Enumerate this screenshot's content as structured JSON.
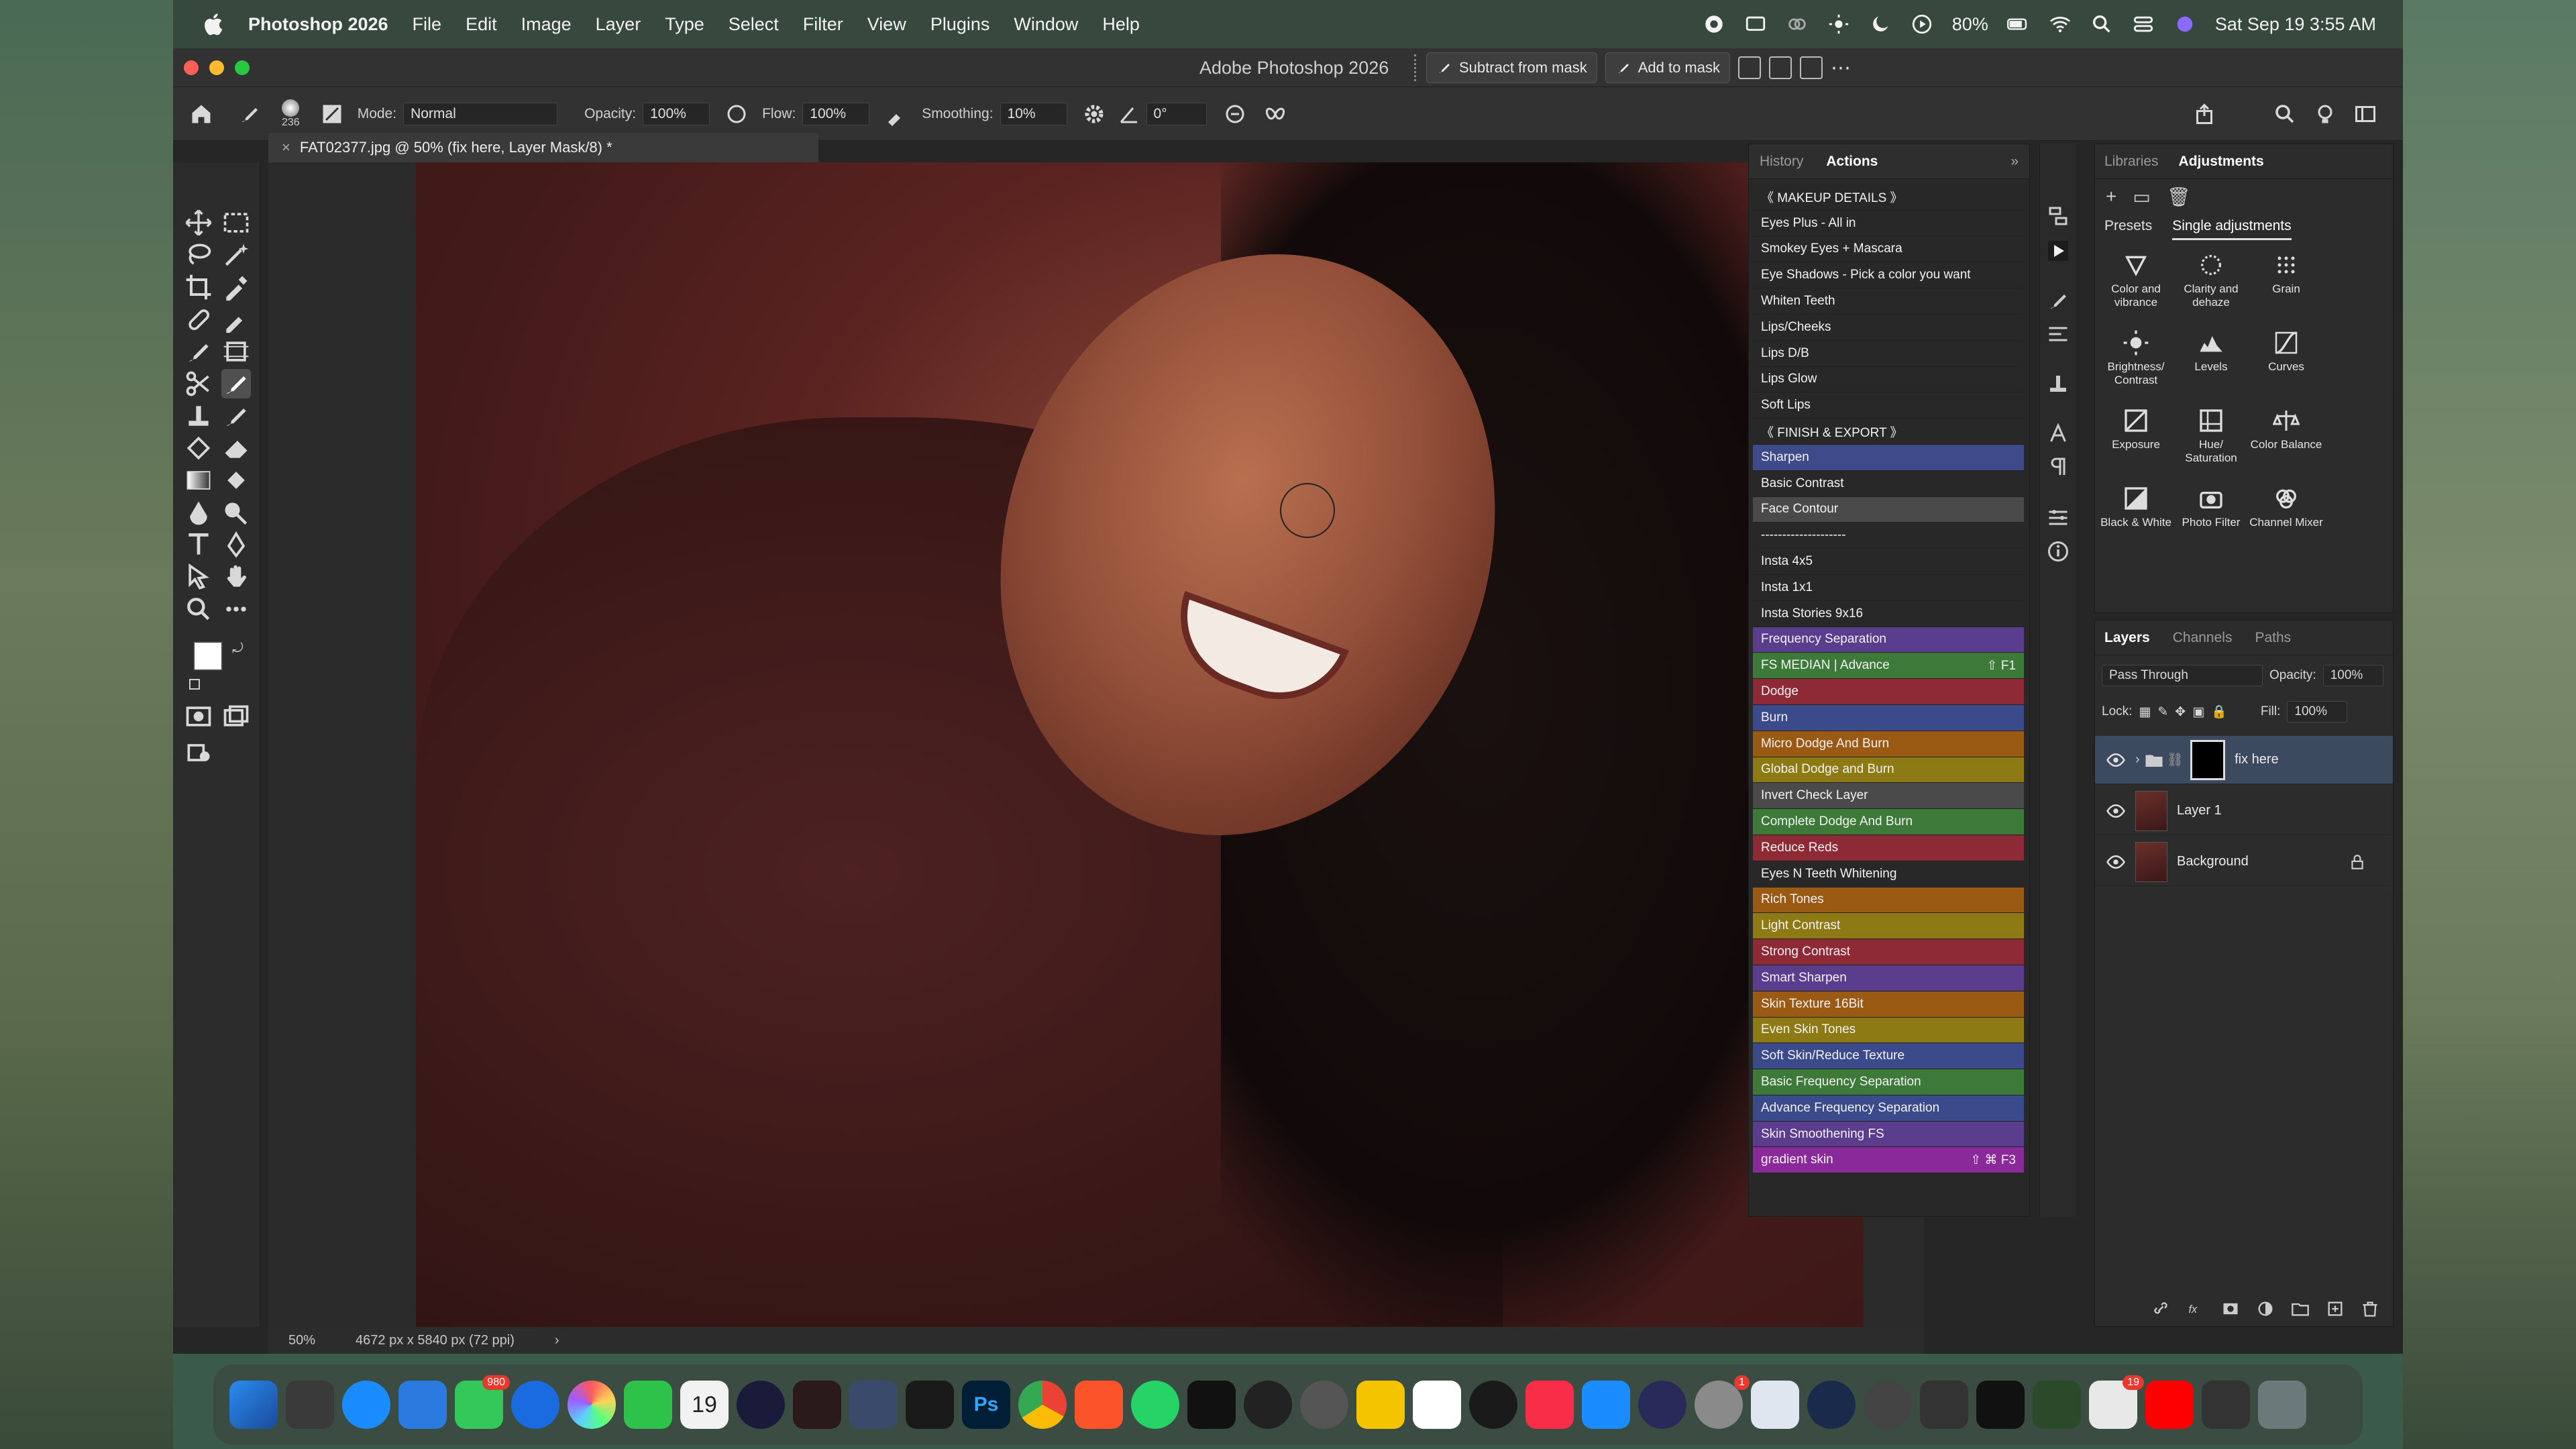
{
  "menubar": {
    "app_name": "Photoshop 2026",
    "items": [
      "File",
      "Edit",
      "Image",
      "Layer",
      "Type",
      "Select",
      "Filter",
      "View",
      "Plugins",
      "Window",
      "Help"
    ],
    "battery": "80%",
    "datetime": "Sat Sep 19  3:55 AM"
  },
  "window": {
    "title": "Adobe Photoshop 2026",
    "subtract_mask_label": "Subtract from mask",
    "add_mask_label": "Add to mask"
  },
  "options": {
    "brush_size": "236",
    "mode_label": "Mode:",
    "mode_value": "Normal",
    "opacity_label": "Opacity:",
    "opacity_value": "100%",
    "flow_label": "Flow:",
    "flow_value": "100%",
    "smoothing_label": "Smoothing:",
    "smoothing_value": "10%",
    "angle_value": "0°"
  },
  "document": {
    "tab_title": "FAT02377.jpg @ 50% (fix here, Layer Mask/8) *",
    "zoom": "50%",
    "doc_info": "4672 px x 5840 px (72 ppi)"
  },
  "actions_panel": {
    "tabs": [
      "History",
      "Actions"
    ],
    "active_tab": "Actions",
    "items": [
      {
        "label": "《 MAKEUP DETAILS 》",
        "color": "#282828",
        "key": ""
      },
      {
        "label": "Eyes Plus - All in",
        "color": "#282828",
        "key": ""
      },
      {
        "label": "Smokey Eyes + Mascara",
        "color": "#282828",
        "key": ""
      },
      {
        "label": "Eye Shadows - Pick a color you want",
        "color": "#282828",
        "key": ""
      },
      {
        "label": "Whiten Teeth",
        "color": "#282828",
        "key": ""
      },
      {
        "label": "Lips/Cheeks",
        "color": "#282828",
        "key": ""
      },
      {
        "label": "Lips D/B",
        "color": "#282828",
        "key": ""
      },
      {
        "label": "Lips Glow",
        "color": "#282828",
        "key": ""
      },
      {
        "label": "Soft Lips",
        "color": "#282828",
        "key": ""
      },
      {
        "label": "《 FINISH & EXPORT 》",
        "color": "#282828",
        "key": ""
      },
      {
        "label": "Sharpen",
        "color": "#3f4a8a",
        "key": ""
      },
      {
        "label": "Basic Contrast",
        "color": "#282828",
        "key": ""
      },
      {
        "label": "Face Contour",
        "color": "#4a4a4a",
        "key": ""
      },
      {
        "label": "--------------------",
        "color": "#282828",
        "key": ""
      },
      {
        "label": "Insta 4x5",
        "color": "#282828",
        "key": ""
      },
      {
        "label": "Insta 1x1",
        "color": "#282828",
        "key": ""
      },
      {
        "label": "Insta Stories 9x16",
        "color": "#282828",
        "key": ""
      },
      {
        "label": "Frequency Separation",
        "color": "#5b3d8e",
        "key": ""
      },
      {
        "label": "FS MEDIAN | Advance",
        "color": "#3d7a3a",
        "key": "⇧ F1"
      },
      {
        "label": "Dodge",
        "color": "#8e2a36",
        "key": ""
      },
      {
        "label": "Burn",
        "color": "#3a4a8a",
        "key": ""
      },
      {
        "label": "Micro Dodge And Burn",
        "color": "#9a5a14",
        "key": ""
      },
      {
        "label": "Global Dodge and Burn",
        "color": "#8e7a14",
        "key": ""
      },
      {
        "label": "Invert Check Layer",
        "color": "#4a4a4a",
        "key": ""
      },
      {
        "label": "Complete Dodge And Burn",
        "color": "#3d7a3a",
        "key": ""
      },
      {
        "label": "Reduce Reds",
        "color": "#8e2a36",
        "key": ""
      },
      {
        "label": "Eyes N Teeth Whitening",
        "color": "#282828",
        "key": ""
      },
      {
        "label": "Rich Tones",
        "color": "#9a5a14",
        "key": ""
      },
      {
        "label": "Light Contrast",
        "color": "#8e7a14",
        "key": ""
      },
      {
        "label": "Strong Contrast",
        "color": "#8e2a36",
        "key": ""
      },
      {
        "label": "Smart Sharpen",
        "color": "#5b3d8e",
        "key": ""
      },
      {
        "label": "Skin Texture 16Bit",
        "color": "#9a5a14",
        "key": ""
      },
      {
        "label": "Even Skin Tones",
        "color": "#8e7a14",
        "key": ""
      },
      {
        "label": "Soft Skin/Reduce Texture",
        "color": "#3a4a8a",
        "key": ""
      },
      {
        "label": "Basic Frequency Separation",
        "color": "#3d7a3a",
        "key": ""
      },
      {
        "label": "Advance Frequency Separation",
        "color": "#3a4a8a",
        "key": ""
      },
      {
        "label": "Skin Smoothening FS",
        "color": "#5b3d8e",
        "key": ""
      },
      {
        "label": "gradient skin",
        "color": "#8a2a9a",
        "key": "⇧ ⌘ F3"
      }
    ]
  },
  "adjustments_panel": {
    "tabs": [
      "Libraries",
      "Adjustments"
    ],
    "active_tab": "Adjustments",
    "subtabs": [
      "Presets",
      "Single adjustments"
    ],
    "active_subtab": "Single adjustments",
    "items": [
      {
        "label": "Color and vibrance",
        "icon": "triangle-icon"
      },
      {
        "label": "Clarity and dehaze",
        "icon": "sparkle-icon"
      },
      {
        "label": "Grain",
        "icon": "grain-icon"
      },
      {
        "label": "Brightness/ Contrast",
        "icon": "sun-icon"
      },
      {
        "label": "Levels",
        "icon": "levels-icon"
      },
      {
        "label": "Curves",
        "icon": "curves-icon"
      },
      {
        "label": "Exposure",
        "icon": "exposure-icon"
      },
      {
        "label": "Hue/ Saturation",
        "icon": "hue-icon"
      },
      {
        "label": "Color Balance",
        "icon": "balance-icon"
      },
      {
        "label": "Black & White",
        "icon": "bw-icon"
      },
      {
        "label": "Photo Filter",
        "icon": "camera-icon"
      },
      {
        "label": "Channel Mixer",
        "icon": "mixer-icon"
      }
    ]
  },
  "layers_panel": {
    "tabs": [
      "Layers",
      "Channels",
      "Paths"
    ],
    "active_tab": "Layers",
    "blend_mode": "Pass Through",
    "opacity_label": "Opacity:",
    "opacity_value": "100%",
    "lock_label": "Lock:",
    "fill_label": "Fill:",
    "fill_value": "100%",
    "layers": [
      {
        "name": "fix here",
        "type": "group"
      },
      {
        "name": "Layer 1",
        "type": "pixel"
      },
      {
        "name": "Background",
        "type": "background"
      }
    ]
  },
  "dock": {
    "calendar_day": "19",
    "messages_badge": "980",
    "settings_badge": "1",
    "reminders_badge": "19"
  }
}
